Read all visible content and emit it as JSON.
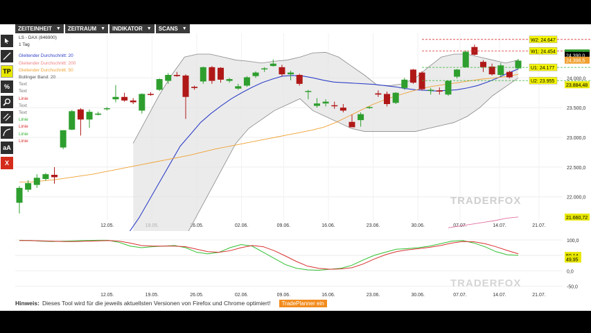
{
  "toolbar": {
    "items": [
      "ZEITEINHEIT",
      "ZEITRAUM",
      "INDIKATOR",
      "SCANS"
    ],
    "dropdown_icon": "triangle-down-icon"
  },
  "sidebar": {
    "tools": [
      {
        "name": "cursor-tool",
        "icon": "arrow-pointer-icon",
        "label": ""
      },
      {
        "name": "line-tool",
        "icon": "diagonal-line-icon",
        "label": ""
      },
      {
        "name": "tradeplanner-tool",
        "icon": "",
        "label": "TP"
      },
      {
        "name": "percent-tool",
        "icon": "percent-icon",
        "label": "%"
      },
      {
        "name": "zoom-tool",
        "icon": "magnifier-icon",
        "label": ""
      },
      {
        "name": "channel-tool",
        "icon": "parallel-lines-icon",
        "label": ""
      },
      {
        "name": "curve-tool",
        "icon": "curve-icon",
        "label": ""
      },
      {
        "name": "text-tool",
        "icon": "",
        "label": "aA"
      },
      {
        "name": "delete-tool",
        "icon": "",
        "label": "X"
      }
    ]
  },
  "legend": {
    "title": "LS - DAX (846900)",
    "interval": "1 Tag",
    "indicators": [
      {
        "label": "Gleitender Durchschnitt: 20",
        "color": "#3040c8"
      },
      {
        "label": "Gleitender Durchschnitt: 200",
        "color": "#f08080"
      },
      {
        "label": "Gleitender Durchschnitt: 50",
        "color": "#f0a030"
      },
      {
        "label": "Bollinger Band: 20",
        "color": "#555555"
      },
      {
        "label": "Text",
        "color": "#777777"
      },
      {
        "label": "Text",
        "color": "#777777"
      },
      {
        "label": "Linie",
        "color": "#d83030"
      },
      {
        "label": "Text",
        "color": "#777777"
      },
      {
        "label": "Text",
        "color": "#777777"
      },
      {
        "label": "Linie",
        "color": "#30b030"
      },
      {
        "label": "Linie",
        "color": "#d83030"
      },
      {
        "label": "Linie",
        "color": "#30b030"
      },
      {
        "label": "Linie",
        "color": "#d83030"
      }
    ]
  },
  "watermark": "TRADERFOX",
  "chart_data": [
    {
      "type": "candlestick",
      "title": "LS - DAX (846900)",
      "x_ticks": [
        "12.05.",
        "19.05.",
        "26.05.",
        "02.06.",
        "09.06.",
        "16.06.",
        "23.06.",
        "30.06.",
        "07.07.",
        "14.07.",
        "21.07."
      ],
      "y_ticks": [
        "22.000,0",
        "22.500,0",
        "23.000,0",
        "23.500,0",
        "24.000,0"
      ],
      "ylim": [
        21600,
        24750
      ],
      "up_color": "#2e9e2e",
      "down_color": "#b01818",
      "candles": [
        {
          "o": 21900,
          "h": 22180,
          "l": 21720,
          "c": 22150
        },
        {
          "o": 22120,
          "h": 22280,
          "l": 22080,
          "c": 22230
        },
        {
          "o": 22200,
          "h": 22380,
          "l": 22150,
          "c": 22320
        },
        {
          "o": 22300,
          "h": 22400,
          "l": 22270,
          "c": 22380
        },
        {
          "o": 22370,
          "h": 22500,
          "l": 22220,
          "c": 22330
        },
        {
          "o": 22830,
          "h": 23100,
          "l": 22800,
          "c": 23120
        },
        {
          "o": 23130,
          "h": 23460,
          "l": 23120,
          "c": 23440
        },
        {
          "o": 23470,
          "h": 23490,
          "l": 23030,
          "c": 23300
        },
        {
          "o": 23300,
          "h": 23470,
          "l": 23160,
          "c": 23430
        },
        {
          "o": 23380,
          "h": 23430,
          "l": 23370,
          "c": 23400
        },
        {
          "o": 23480,
          "h": 23510,
          "l": 23450,
          "c": 23490
        },
        {
          "o": 23640,
          "h": 23880,
          "l": 23590,
          "c": 23680
        },
        {
          "o": 23680,
          "h": 23750,
          "l": 23600,
          "c": 23620
        },
        {
          "o": 23620,
          "h": 23660,
          "l": 23560,
          "c": 23590
        },
        {
          "o": 23450,
          "h": 23740,
          "l": 23400,
          "c": 23730
        },
        {
          "o": 23730,
          "h": 23760,
          "l": 23700,
          "c": 23720
        },
        {
          "o": 23800,
          "h": 23990,
          "l": 23780,
          "c": 23980
        },
        {
          "o": 23950,
          "h": 24080,
          "l": 23900,
          "c": 24050
        },
        {
          "o": 24050,
          "h": 24100,
          "l": 24020,
          "c": 24030
        },
        {
          "o": 24040,
          "h": 24060,
          "l": 23310,
          "c": 23680
        },
        {
          "o": 23850,
          "h": 23870,
          "l": 23800,
          "c": 23830
        },
        {
          "o": 23940,
          "h": 24190,
          "l": 23900,
          "c": 24180
        },
        {
          "o": 24180,
          "h": 24200,
          "l": 23900,
          "c": 23950
        },
        {
          "o": 24170,
          "h": 24180,
          "l": 23920,
          "c": 23970
        },
        {
          "o": 23950,
          "h": 24000,
          "l": 23920,
          "c": 23980
        },
        {
          "o": 23820,
          "h": 23900,
          "l": 23800,
          "c": 23860
        },
        {
          "o": 23870,
          "h": 24030,
          "l": 23850,
          "c": 24010
        },
        {
          "o": 24030,
          "h": 24110,
          "l": 24000,
          "c": 24090
        },
        {
          "o": 24160,
          "h": 24180,
          "l": 24100,
          "c": 24160
        },
        {
          "o": 24200,
          "h": 24310,
          "l": 24190,
          "c": 24240
        },
        {
          "o": 24180,
          "h": 24220,
          "l": 24030,
          "c": 24060
        },
        {
          "o": 24060,
          "h": 24120,
          "l": 23960,
          "c": 24090
        },
        {
          "o": 24050,
          "h": 24070,
          "l": 23870,
          "c": 23900
        },
        {
          "o": 23780,
          "h": 23800,
          "l": 23640,
          "c": 23780
        },
        {
          "o": 23530,
          "h": 23660,
          "l": 23500,
          "c": 23570
        },
        {
          "o": 23570,
          "h": 23640,
          "l": 23520,
          "c": 23600
        },
        {
          "o": 23540,
          "h": 23600,
          "l": 23480,
          "c": 23530
        },
        {
          "o": 23500,
          "h": 23560,
          "l": 23420,
          "c": 23450
        },
        {
          "o": 23260,
          "h": 23380,
          "l": 23200,
          "c": 23170
        },
        {
          "o": 23290,
          "h": 23420,
          "l": 23180,
          "c": 23390
        },
        {
          "o": 23500,
          "h": 23520,
          "l": 23480,
          "c": 23510
        },
        {
          "o": 23740,
          "h": 23790,
          "l": 23680,
          "c": 23720
        },
        {
          "o": 23730,
          "h": 23770,
          "l": 23520,
          "c": 23560
        },
        {
          "o": 23580,
          "h": 23760,
          "l": 23560,
          "c": 23750
        },
        {
          "o": 23830,
          "h": 24000,
          "l": 23800,
          "c": 23970
        },
        {
          "o": 24140,
          "h": 24150,
          "l": 23900,
          "c": 23920
        },
        {
          "o": 24090,
          "h": 24110,
          "l": 23790,
          "c": 23810
        },
        {
          "o": 23790,
          "h": 23830,
          "l": 23720,
          "c": 23800
        },
        {
          "o": 23790,
          "h": 23840,
          "l": 23720,
          "c": 23770
        },
        {
          "o": 23720,
          "h": 23960,
          "l": 23700,
          "c": 23950
        },
        {
          "o": 24020,
          "h": 24150,
          "l": 23990,
          "c": 24140
        },
        {
          "o": 24180,
          "h": 24460,
          "l": 24170,
          "c": 24440
        },
        {
          "o": 24520,
          "h": 24560,
          "l": 24380,
          "c": 24390
        },
        {
          "o": 24270,
          "h": 24300,
          "l": 24100,
          "c": 24180
        },
        {
          "o": 24190,
          "h": 24240,
          "l": 24040,
          "c": 24060
        },
        {
          "o": 24050,
          "h": 24250,
          "l": 24030,
          "c": 24210
        },
        {
          "o": 24100,
          "h": 24120,
          "l": 23990,
          "c": 24010
        },
        {
          "o": 24160,
          "h": 24320,
          "l": 24140,
          "c": 24290
        }
      ],
      "series": [
        {
          "name": "Gleitender Durchschnitt: 20",
          "color": "#3040c8",
          "values": [
            20870,
            21000,
            21180,
            21400,
            21650,
            21950,
            22250,
            22550,
            22850,
            23050,
            23250,
            23400,
            23530,
            23650,
            23750,
            23840,
            23920,
            23980,
            24030,
            24040,
            24030,
            24000,
            23960,
            23930,
            23920,
            23910,
            23900,
            23890,
            23870,
            23850,
            23820,
            23800,
            23790,
            23780,
            23790,
            23800,
            23830,
            23870,
            23930,
            24000,
            24080,
            24150
          ]
        },
        {
          "name": "Gleitender Durchschnitt: 50",
          "color": "#f0a030",
          "values": [
            22250,
            22250,
            22270,
            22290,
            22320,
            22350,
            22380,
            22420,
            22460,
            22500,
            22540,
            22580,
            22620,
            22660,
            22700,
            22750,
            22800,
            22840,
            22880,
            22920,
            22960,
            23000,
            23040,
            23080,
            23120,
            23170,
            23250,
            23350,
            23450,
            23550,
            23630,
            23700,
            23760,
            23820,
            23860,
            23890,
            23920,
            23950,
            23980,
            24000,
            24020,
            24060
          ]
        },
        {
          "name": "Bollinger Band: 20",
          "color": "#888888",
          "values_upper": [
            22900,
            23300,
            23700,
            24050,
            24350,
            24400,
            24400,
            24350,
            24300,
            24280,
            24250,
            24280,
            24300,
            24350,
            24420,
            24430,
            24350,
            24200,
            24050,
            23880,
            23870,
            23900,
            24000,
            24180,
            24350,
            24400,
            24400,
            24350,
            24300,
            24250,
            24300
          ],
          "values_lower": [
            20900,
            20700,
            20800,
            21000,
            21300,
            21700,
            22100,
            22500,
            22900,
            23150,
            23300,
            23450,
            23550,
            23650,
            23450,
            23350,
            23250,
            23150,
            23100,
            23100,
            23100,
            23100,
            23100,
            23150,
            23200,
            23250,
            23350,
            23500,
            23700,
            23850,
            24000
          ]
        },
        {
          "name": "Gleitender Durchschnitt: 200",
          "color": "#e070a0",
          "values": [
            21480,
            21510,
            21540,
            21570,
            21600,
            21640,
            21660
          ]
        }
      ],
      "price_labels": [
        {
          "label": "W2: 24.647",
          "value": 24647,
          "color": "#d83030"
        },
        {
          "label": "W1: 24.454",
          "value": 24454,
          "color": "#d83030"
        },
        {
          "label": "U1: 24.177",
          "value": 24177,
          "color": "#30b030"
        },
        {
          "label": "U2: 23.955",
          "value": 23955,
          "color": "#30b030"
        }
      ],
      "axis_badges": [
        {
          "text": "24.398,5",
          "value": 24420,
          "bg": "#2e9e2e",
          "fg": "#fff"
        },
        {
          "text": "24.390,0",
          "value": 24380,
          "bg": "#000000",
          "fg": "#fff"
        },
        {
          "text": "24.398,5",
          "value": 24298,
          "bg": "#f0a030",
          "fg": "#fff"
        },
        {
          "text": "23.884,48",
          "value": 23884,
          "bg": "#e8e800",
          "fg": "#000"
        },
        {
          "text": "21.660,72",
          "value": 21660,
          "bg": "#e8e800",
          "fg": "#000"
        }
      ]
    },
    {
      "type": "line",
      "title": "",
      "y_ticks": [
        "100,0",
        "50,0",
        "0,0",
        "-50,0"
      ],
      "ylim": [
        -60,
        120
      ],
      "x_ticks": [
        "12.05.",
        "19.05.",
        "26.05.",
        "02.06.",
        "09.06.",
        "16.06.",
        "23.06.",
        "30.06.",
        "07.07.",
        "14.07.",
        "21.07."
      ],
      "series": [
        {
          "name": "",
          "color": "#30c030",
          "values": [
            99,
            98,
            96,
            95,
            96,
            97,
            98,
            99,
            99,
            92,
            80,
            75,
            78,
            80,
            82,
            75,
            60,
            55,
            60,
            75,
            85,
            80,
            60,
            40,
            20,
            8,
            3,
            2,
            5,
            8,
            18,
            35,
            50,
            60,
            70,
            72,
            75,
            80,
            88,
            96,
            98,
            90,
            78,
            62,
            52,
            50
          ]
        },
        {
          "name": "",
          "color": "#d83030",
          "values": [
            98,
            98,
            97,
            96,
            95,
            95,
            96,
            97,
            98,
            96,
            90,
            82,
            80,
            80,
            80,
            78,
            70,
            62,
            60,
            65,
            75,
            82,
            78,
            65,
            48,
            30,
            15,
            8,
            5,
            6,
            10,
            22,
            38,
            52,
            62,
            68,
            72,
            76,
            82,
            90,
            95,
            94,
            88,
            78,
            66,
            55
          ]
        }
      ],
      "axis_badges": [
        {
          "text": "50,14",
          "value": 50,
          "bg": "#e8e800",
          "fg": "#000"
        },
        {
          "text": "49,95",
          "value": 38,
          "bg": "#e8e800",
          "fg": "#000"
        }
      ]
    }
  ],
  "footer": {
    "hint_label": "Hinweis:",
    "hint_text": "Dieses Tool wird für die jeweils aktuellsten Versionen von Firefox und Chrome optimiert!",
    "button": "TradePlanner ein"
  }
}
